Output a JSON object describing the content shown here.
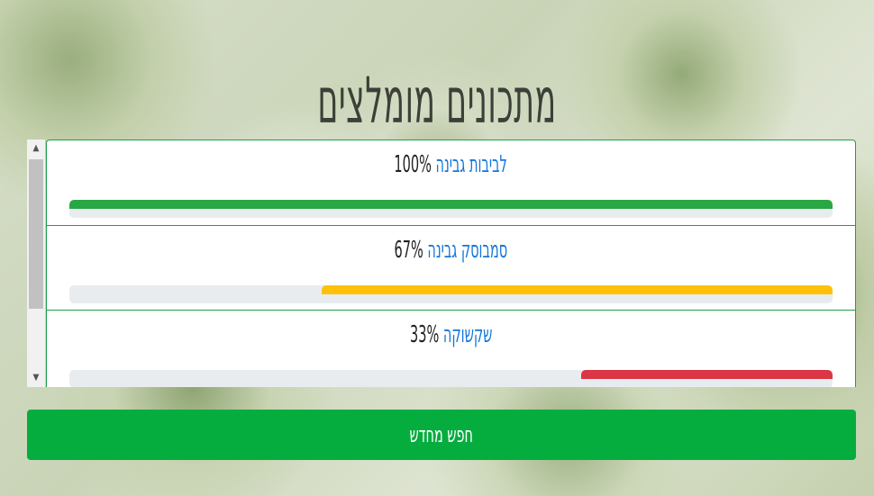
{
  "page": {
    "title": "מתכונים מומלצים"
  },
  "recipes": [
    {
      "name": "לביבות גבינה",
      "percent_label": "100%",
      "match": 1.0,
      "color": "#28a745"
    },
    {
      "name": "סמבוסק גבינה",
      "percent_label": "67%",
      "match": 0.67,
      "color": "#ffc107"
    },
    {
      "name": "שקשוקה",
      "percent_label": "33%",
      "match": 0.33,
      "color": "#dc3545"
    }
  ],
  "scrollbar": {
    "up_icon": "triangle-up",
    "down_icon": "triangle-down"
  },
  "actions": {
    "search_again_label": "חפש מחדש"
  }
}
